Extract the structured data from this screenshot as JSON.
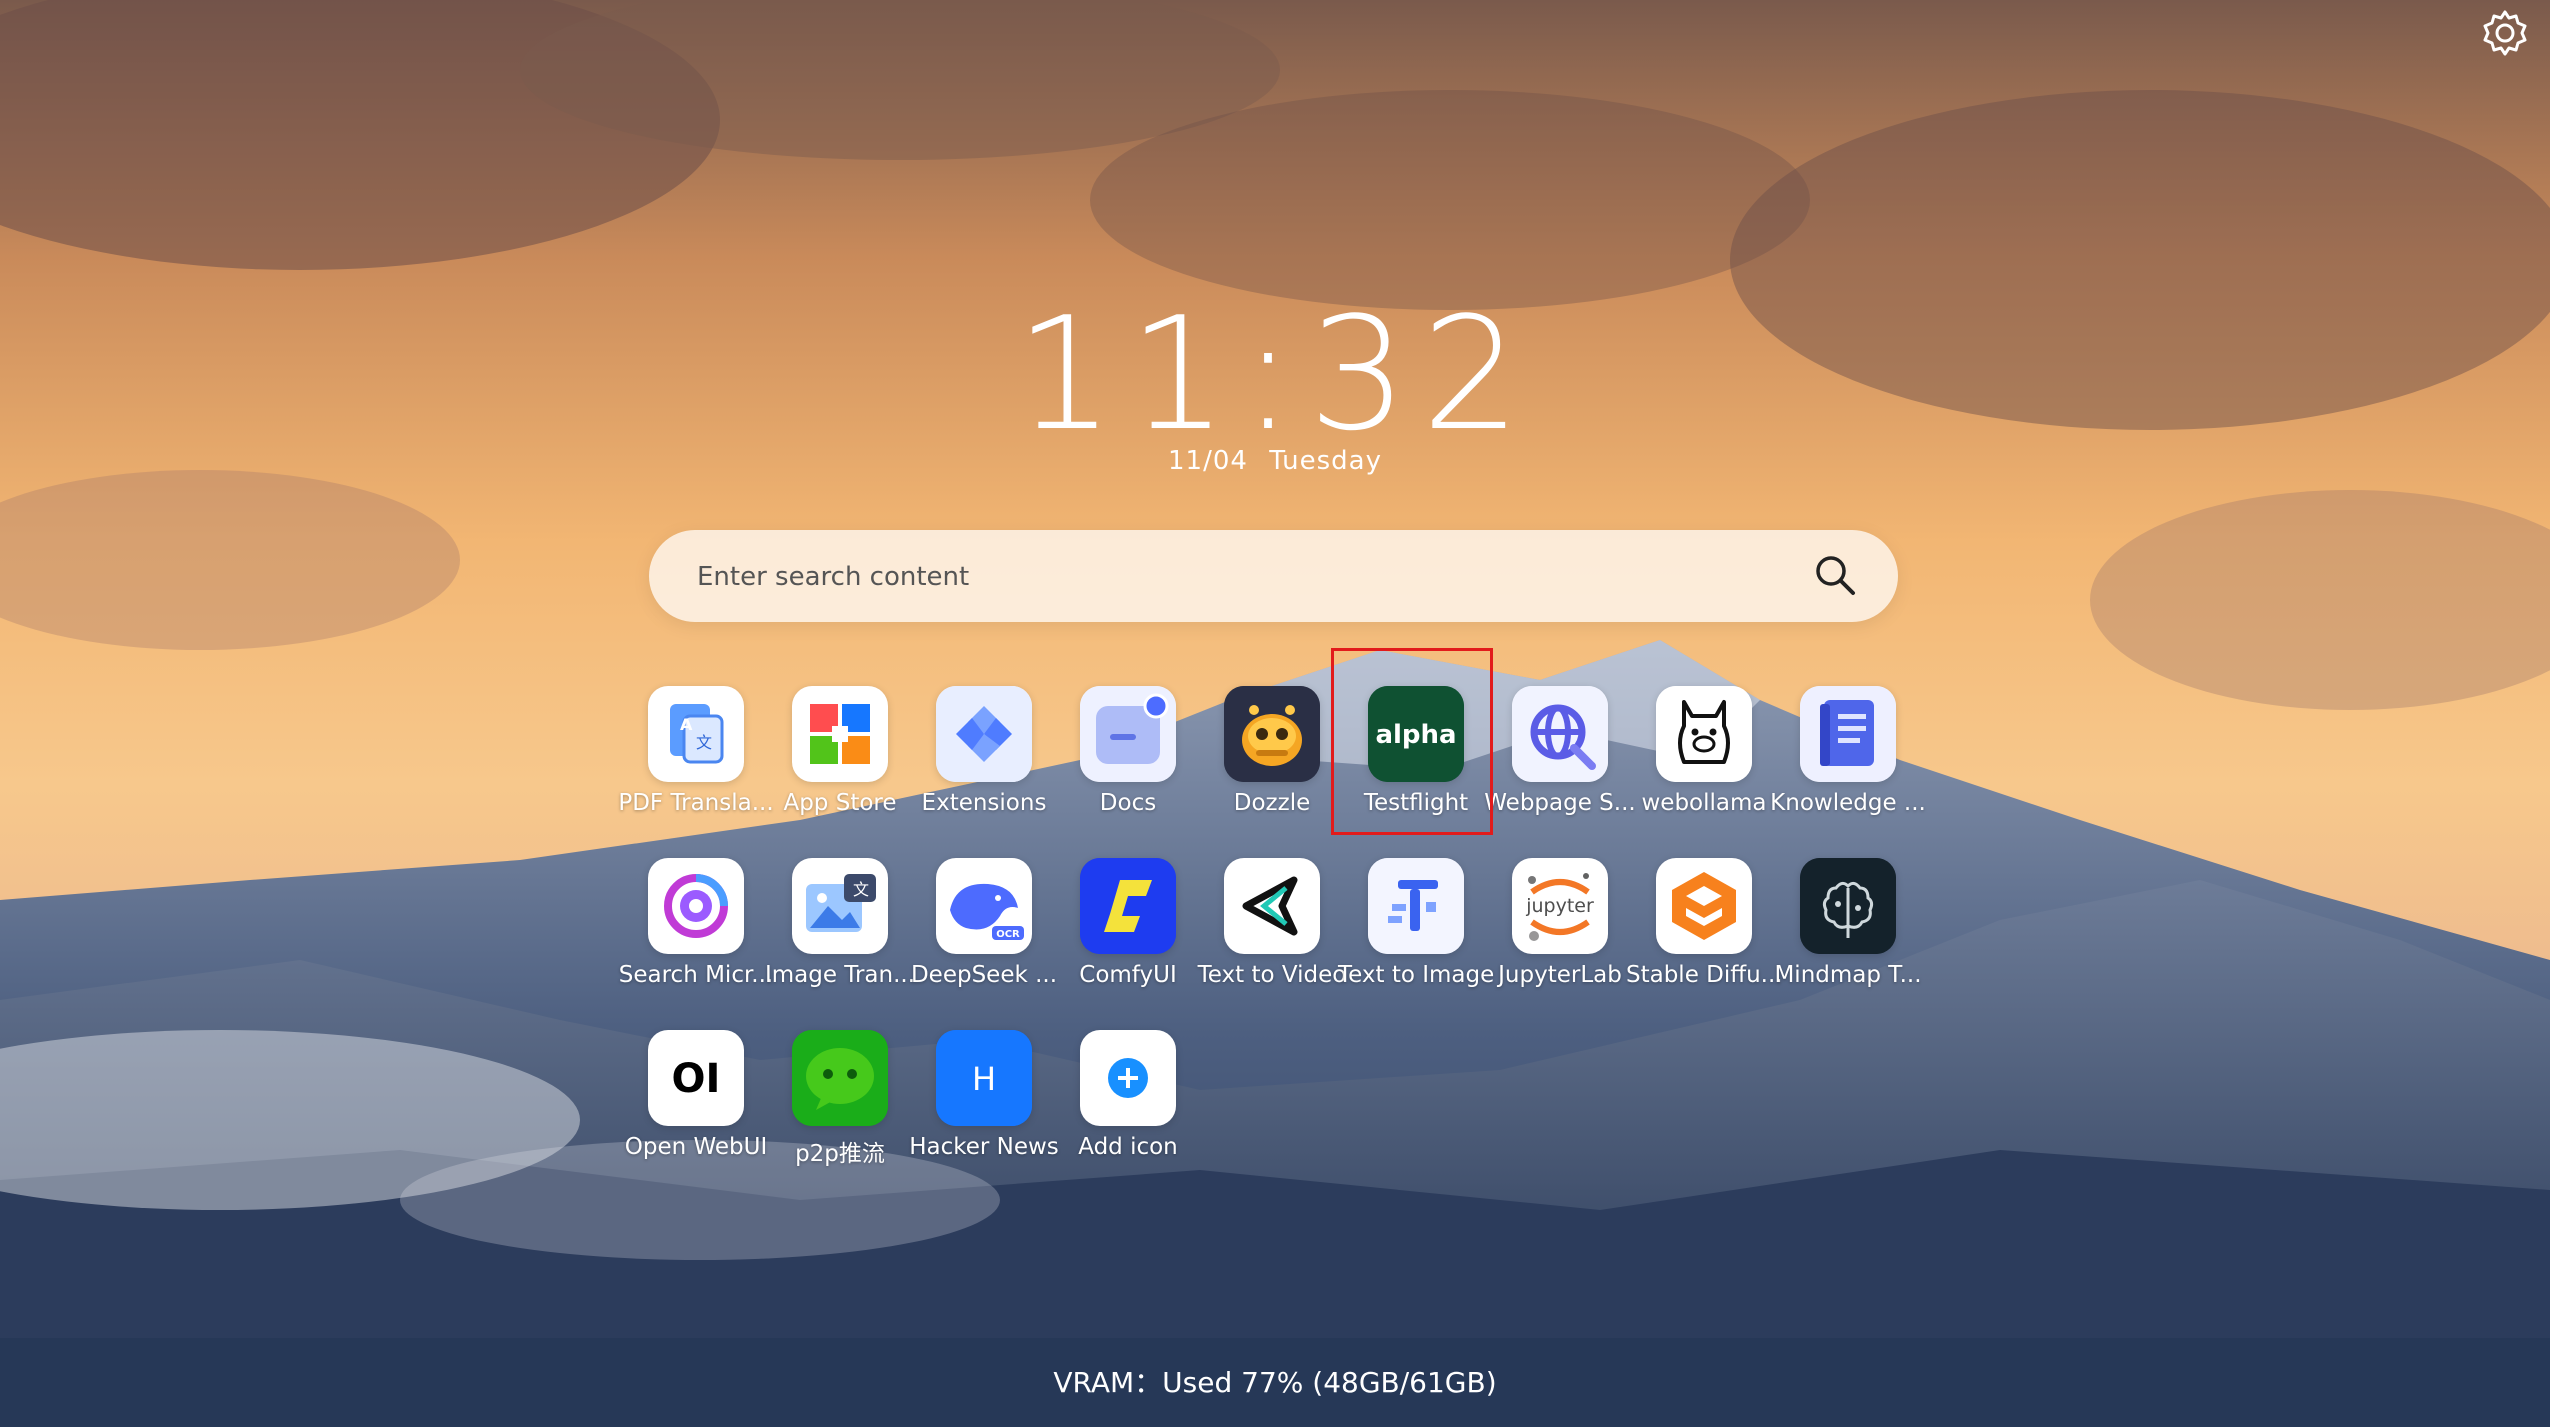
{
  "clock": {
    "time": "11:32",
    "date": "11/04",
    "weekday": "Tuesday"
  },
  "search": {
    "placeholder": "Enter search content"
  },
  "apps": [
    {
      "label": "PDF Transla...",
      "icon": "pdf-translate-icon"
    },
    {
      "label": "App Store",
      "icon": "app-store-icon"
    },
    {
      "label": "Extensions",
      "icon": "extensions-icon"
    },
    {
      "label": "Docs",
      "icon": "docs-icon"
    },
    {
      "label": "Dozzle",
      "icon": "dozzle-icon"
    },
    {
      "label": "Testflight",
      "icon": "testflight-alpha-icon",
      "icon_text": "alpha"
    },
    {
      "label": "Webpage S...",
      "icon": "webpage-icon"
    },
    {
      "label": "webollama",
      "icon": "llama-icon"
    },
    {
      "label": "Knowledge ...",
      "icon": "knowledge-book-icon"
    },
    {
      "label": "Search Micr...",
      "icon": "search-circle-icon"
    },
    {
      "label": "Image Tran...",
      "icon": "image-translate-icon"
    },
    {
      "label": "DeepSeek ...",
      "icon": "deepseek-whale-icon",
      "icon_text": "OCR"
    },
    {
      "label": "ComfyUI",
      "icon": "comfyui-icon"
    },
    {
      "label": "Text to Video",
      "icon": "text-to-video-icon"
    },
    {
      "label": "Text to Image",
      "icon": "text-to-image-icon"
    },
    {
      "label": "JupyterLab",
      "icon": "jupyter-icon",
      "icon_text": "jupyter"
    },
    {
      "label": "Stable Diffu...",
      "icon": "stable-diffusion-icon"
    },
    {
      "label": "Mindmap T...",
      "icon": "mindmap-brain-icon"
    },
    {
      "label": "Open WebUI",
      "icon": "open-webui-icon",
      "icon_text": "OI"
    },
    {
      "label": "p2p推流",
      "icon": "wechat-icon"
    },
    {
      "label": "Hacker News",
      "icon": "hacker-news-icon",
      "icon_text": "H"
    },
    {
      "label": "Add icon",
      "icon": "add-icon"
    }
  ],
  "status": {
    "vram": "VRAM：Used 77% (48GB/61GB)"
  },
  "colors": {
    "highlight": "#e21b1b",
    "testflight": "#0f5132",
    "hacker_news": "#1677ff",
    "comfy": "#1e3cf0"
  }
}
